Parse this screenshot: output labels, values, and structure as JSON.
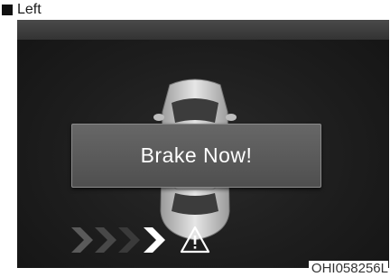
{
  "caption": {
    "label": "Left"
  },
  "display": {
    "alert_text": "Brake Now!",
    "direction_arrows": 4,
    "active_arrows": 1,
    "warning_icon": "warning-triangle-icon"
  },
  "figure_code": "OHI058256L"
}
